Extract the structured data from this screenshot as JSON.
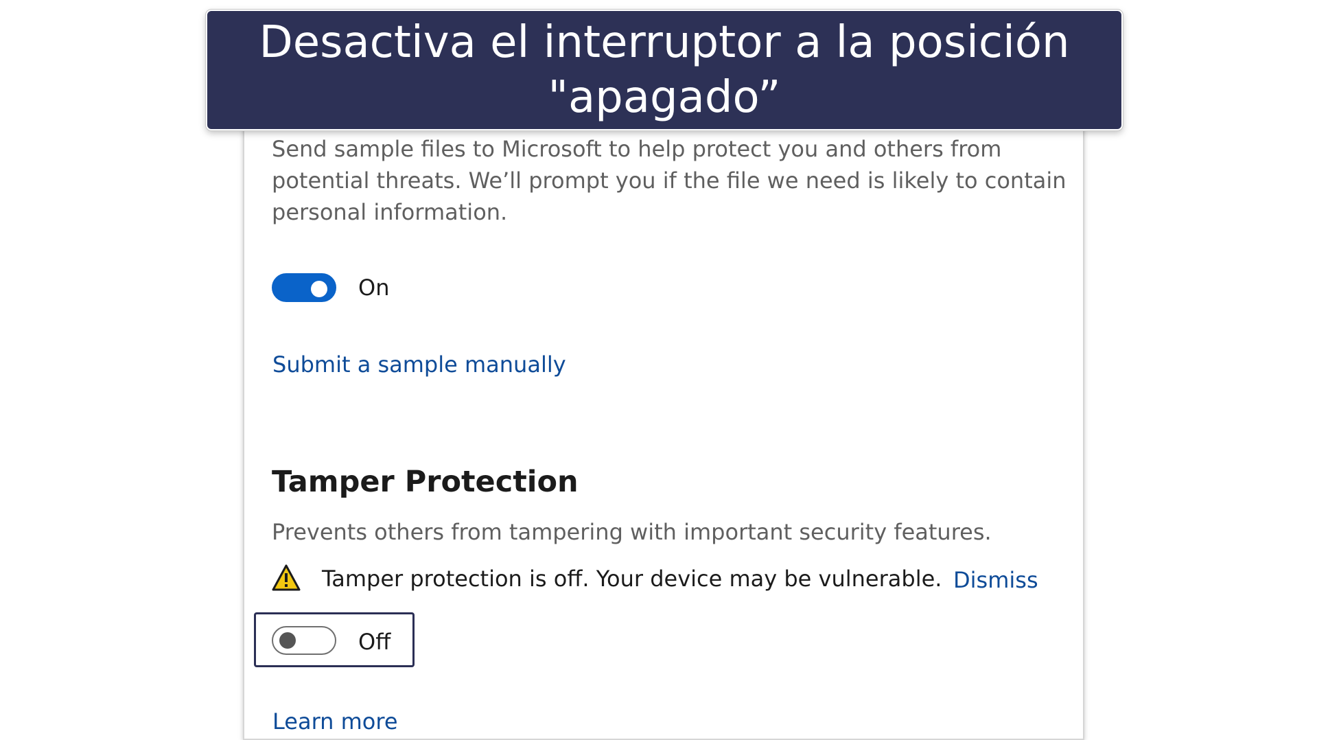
{
  "banner": {
    "caption": "Desactiva el interruptor a la posición \"apagado”"
  },
  "cloud_protection": {
    "description": "Send sample files to Microsoft to help protect you and others from potential threats. We’ll prompt you if the file we need is likely to contain personal information.",
    "toggle_state": "on",
    "toggle_label": "On",
    "submit_link": "Submit a sample manually"
  },
  "tamper_protection": {
    "title": "Tamper Protection",
    "description": "Prevents others from tampering with important security features.",
    "warning_icon": "warning-triangle-icon",
    "warning_text": "Tamper protection is off. Your device may be vulnerable.",
    "dismiss_link": "Dismiss",
    "toggle_state": "off",
    "toggle_label": "Off",
    "learn_more_link": "Learn more"
  },
  "colors": {
    "banner_bg": "#2d3156",
    "toggle_on": "#0a63c9",
    "link": "#0e4b98",
    "warning": "#f2c811"
  }
}
